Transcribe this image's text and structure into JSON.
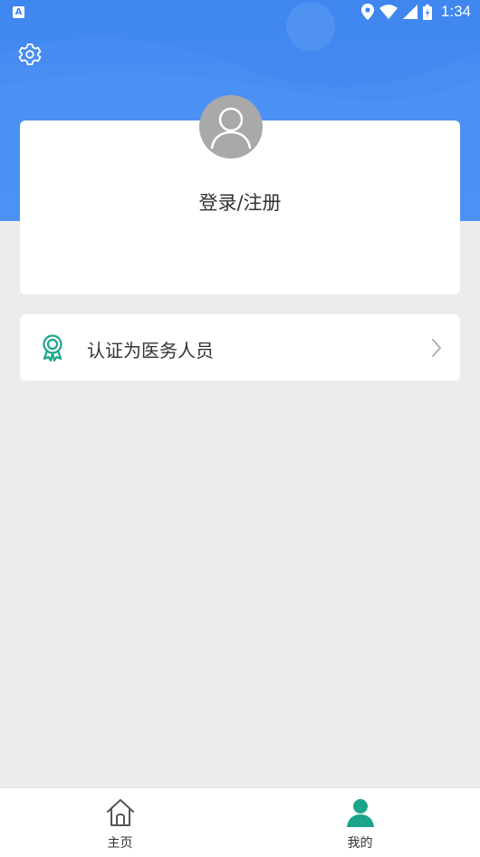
{
  "status_bar": {
    "app_icon_letter": "A",
    "time": "1:34"
  },
  "colors": {
    "header_blue": "#3f86ef",
    "accent_teal": "#1aa58a",
    "background": "#ececec"
  },
  "profile": {
    "login_label": "登录/注册"
  },
  "menu": {
    "certify_label": "认证为医务人员"
  },
  "bottom_nav": {
    "home_label": "主页",
    "mine_label": "我的",
    "active": "mine"
  }
}
